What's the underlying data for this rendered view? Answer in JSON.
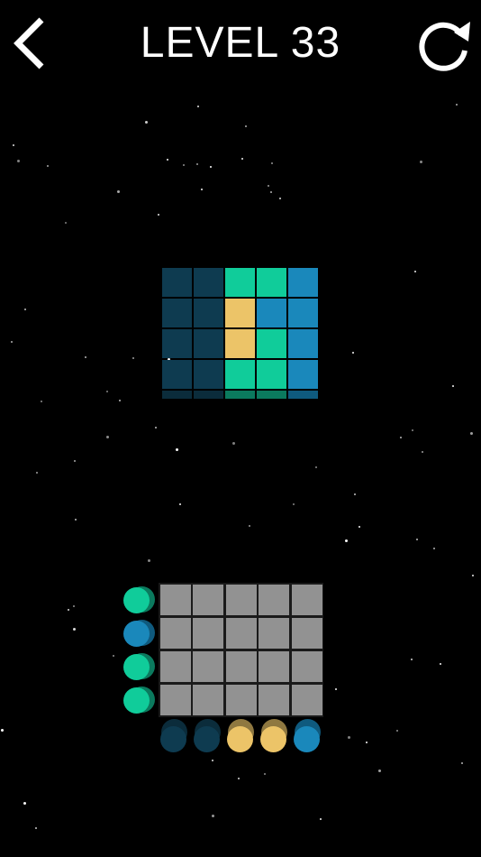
{
  "header": {
    "title": "LEVEL 33"
  },
  "colors": {
    "background": "#000000",
    "dark_navy": "#0e3b50",
    "teal": "#10cc9a",
    "blue": "#1a88bb",
    "yellow": "#ecc468",
    "empty_cell": "#929292"
  },
  "icons": {
    "back": "chevron-left-icon",
    "restart": "restart-icon"
  },
  "target": {
    "rows": [
      [
        "dark_navy",
        "dark_navy",
        "teal",
        "teal",
        "blue"
      ],
      [
        "dark_navy",
        "dark_navy",
        "yellow",
        "blue",
        "blue"
      ],
      [
        "dark_navy",
        "dark_navy",
        "yellow",
        "teal",
        "blue"
      ],
      [
        "dark_navy",
        "dark_navy",
        "teal",
        "teal",
        "blue"
      ]
    ]
  },
  "board": {
    "rows": 4,
    "cols": 5
  },
  "row_dots": [
    "teal",
    "blue",
    "teal",
    "teal"
  ],
  "column_dots": [
    "dark_navy",
    "dark_navy",
    "yellow",
    "yellow",
    "blue"
  ]
}
